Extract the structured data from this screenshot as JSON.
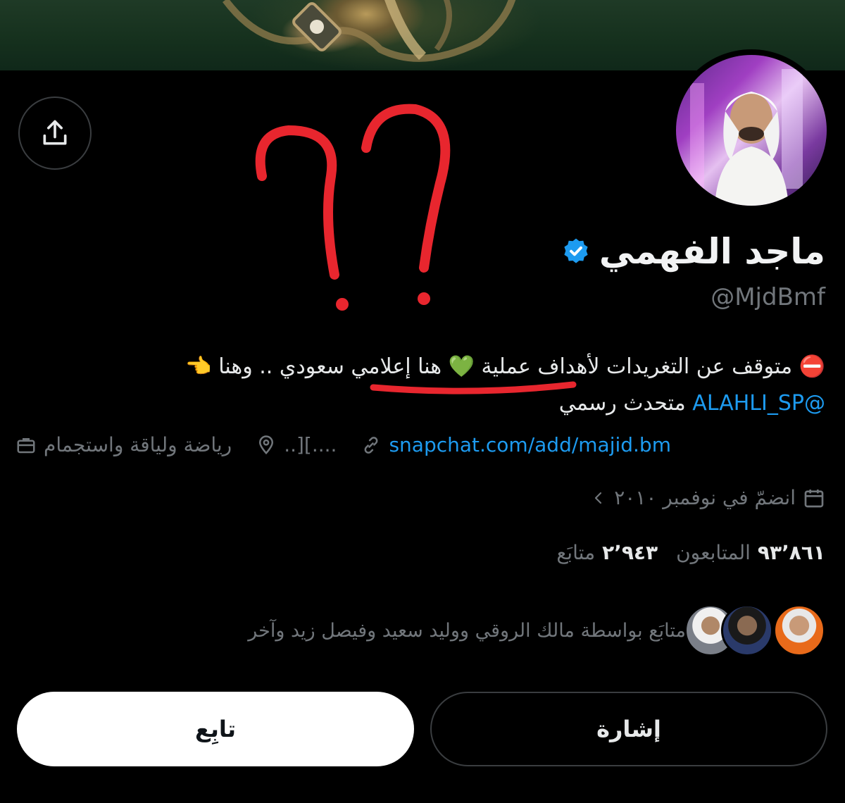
{
  "profile": {
    "name": "ماجد الفهمي",
    "handle": "@MjdBmf",
    "bio_line1": "⛔️ متوقف عن التغريدات لأهداف عملية 💚 هنا إعلامي سعودي .. وهنا 👈",
    "bio_mention": "@ALAHLI_SP",
    "bio_line2_rest": " متحدث رسمي",
    "category": "رياضة ولياقة واستجمام",
    "location": "....][..",
    "website": "snapchat.com/add/majid.bm",
    "joined": "انضمّ في نوفمبر ٢٠١٠"
  },
  "stats": {
    "following_count": "٢٬٩٤٣",
    "following_label": "متابَع",
    "followers_count": "٩٣٬٨٦١",
    "followers_label": "المتابعون"
  },
  "followed_by": {
    "text": "متابَع بواسطة مالك الروقي ووليد سعيد وفيصل زيد وآخر"
  },
  "actions": {
    "follow_label": "تابِع",
    "mention_label": "إشارة"
  },
  "colors": {
    "accent": "#1d9bf0",
    "verified": "#1d9bf0",
    "annotation_red": "#e8262e",
    "background": "#000000"
  }
}
